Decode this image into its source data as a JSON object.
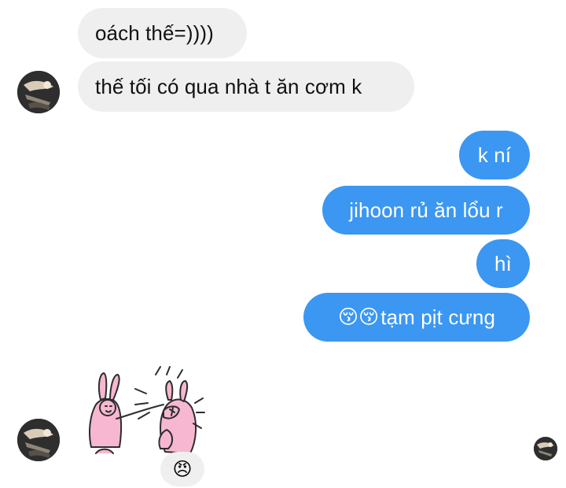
{
  "conversation": {
    "incoming_messages": [
      {
        "text": "oách thế=))))"
      },
      {
        "text": "thế tối có qua nhà t ăn cơm k"
      }
    ],
    "outgoing_messages": [
      {
        "text": "k ní"
      },
      {
        "text": "jihoon rủ ăn lổu r"
      },
      {
        "text": "hì"
      },
      {
        "emoji": "😚😚",
        "text": "tạm pịt cưng"
      }
    ],
    "sticker": {
      "description_icon": "bunny-punch-sticker-icon"
    },
    "reaction": {
      "emoji": "😠"
    }
  },
  "colors": {
    "incoming_bubble": "#efefef",
    "outgoing_bubble": "#3b97f2",
    "incoming_text": "#111111",
    "outgoing_text": "#ffffff",
    "sticker_pink": "#f7b7d1"
  }
}
